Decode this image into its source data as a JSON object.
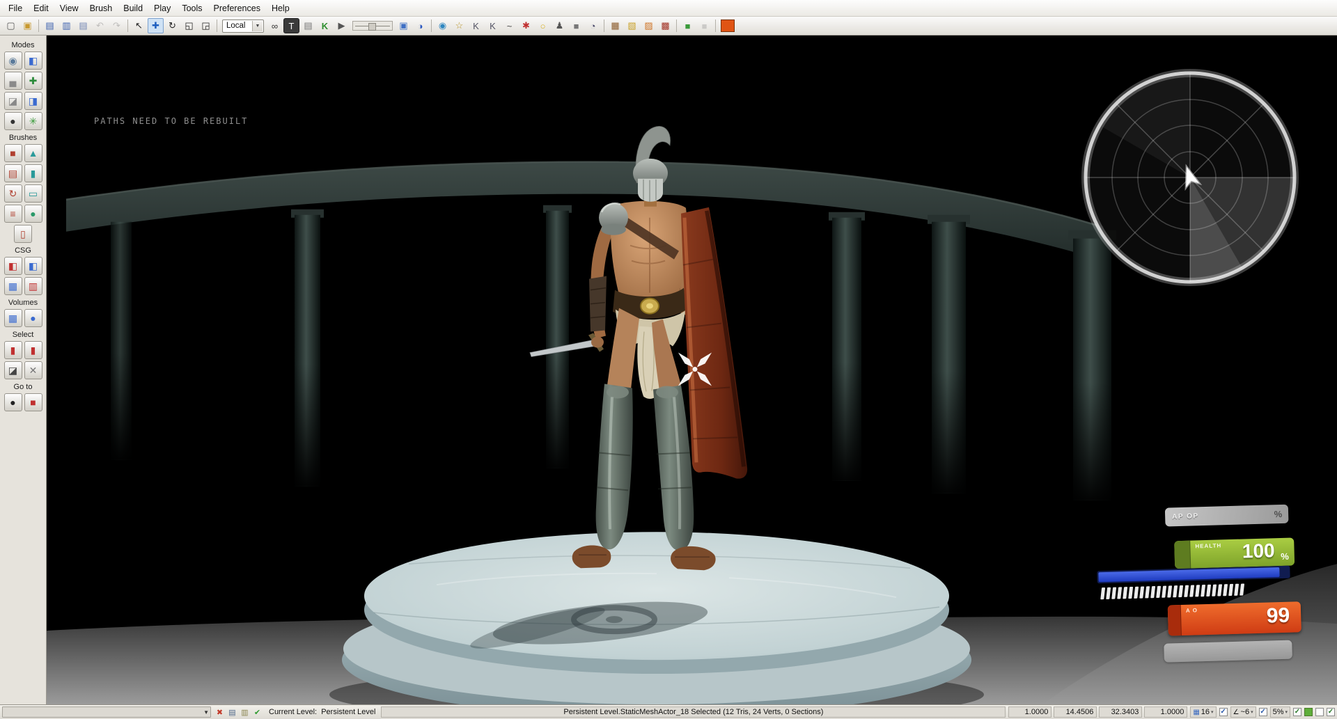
{
  "menu": {
    "items": [
      "File",
      "Edit",
      "View",
      "Brush",
      "Build",
      "Play",
      "Tools",
      "Preferences",
      "Help"
    ]
  },
  "toolbar": {
    "combo_value": "Local",
    "items": [
      {
        "name": "new-level",
        "glyph": "▢",
        "color": "#555"
      },
      {
        "name": "open-level",
        "glyph": "▣",
        "color": "#c8992f"
      },
      {
        "sep": true
      },
      {
        "name": "save-current-level",
        "glyph": "▤",
        "color": "#3a5fae"
      },
      {
        "name": "save-all-levels",
        "glyph": "▥",
        "color": "#3a5fae"
      },
      {
        "name": "save-all-writable",
        "glyph": "▤",
        "color": "#7387b5"
      },
      {
        "name": "undo",
        "glyph": "↶",
        "color": "#777",
        "disabled": true
      },
      {
        "name": "redo",
        "glyph": "↷",
        "color": "#777",
        "disabled": true
      },
      {
        "sep": true
      },
      {
        "name": "selection-tool",
        "glyph": "↖",
        "color": "#222"
      },
      {
        "name": "translate-tool",
        "glyph": "✚",
        "color": "#1f5fbf",
        "active": true
      },
      {
        "name": "rotate-tool",
        "glyph": "↻",
        "color": "#222"
      },
      {
        "name": "scale-tool",
        "glyph": "◱",
        "color": "#222"
      },
      {
        "name": "nonuniform-scale-tool",
        "glyph": "◲",
        "color": "#222"
      },
      {
        "sep": true
      },
      {
        "combo": true,
        "name": "reference-coordinate-system"
      },
      {
        "name": "search-for-actors",
        "glyph": "∞",
        "color": "#333"
      },
      {
        "name": "content-browser",
        "glyph": "T",
        "color": "#ffffff",
        "bg": "#3a3a3a"
      },
      {
        "name": "generic-browser",
        "glyph": "▤",
        "color": "#777"
      },
      {
        "name": "open-kismet",
        "glyph": "K",
        "color": "#2d8f2d",
        "bold": true
      },
      {
        "name": "open-matinee",
        "glyph": "▶",
        "color": "#555"
      },
      {
        "wide": true,
        "name": "distribution-widget"
      },
      {
        "name": "package-folder",
        "glyph": "▣",
        "color": "#3e6fc4"
      },
      {
        "name": "toggle-brush-polys",
        "glyph": "◑",
        "color": "#2a58c0"
      },
      {
        "sep": true
      },
      {
        "name": "build-geometry",
        "glyph": "◉",
        "color": "#2e86c0"
      },
      {
        "name": "favorites",
        "glyph": "☆",
        "color": "#b8952a"
      },
      {
        "name": "camera-speed-slow",
        "glyph": "K",
        "color": "#556"
      },
      {
        "name": "camera-speed-fast",
        "glyph": "K",
        "color": "#556"
      },
      {
        "name": "curve-editor",
        "glyph": "~",
        "color": "#444"
      },
      {
        "name": "build-ai-paths",
        "glyph": "✱",
        "color": "#c03030"
      },
      {
        "name": "build-lighting",
        "glyph": "○",
        "color": "#d8b020"
      },
      {
        "name": "build-cover-nodes",
        "glyph": "♟",
        "color": "#555"
      },
      {
        "name": "build-all",
        "glyph": "■",
        "color": "#777"
      },
      {
        "name": "build-progress-clock",
        "glyph": "◔",
        "color": "#446"
      },
      {
        "sep": true
      },
      {
        "name": "terrain-tool",
        "glyph": "▦",
        "color": "#8a5a2a"
      },
      {
        "name": "lightmass-tool",
        "glyph": "▧",
        "color": "#c9a22a"
      },
      {
        "name": "swarm-agent",
        "glyph": "▨",
        "color": "#cf7426"
      },
      {
        "name": "map-errors",
        "glyph": "▩",
        "color": "#a23326"
      },
      {
        "sep": true
      },
      {
        "name": "play-in-editor",
        "glyph": "■",
        "color": "#3a9a3a"
      },
      {
        "name": "play-on-device",
        "glyph": "■",
        "color": "#999",
        "disabled": true
      },
      {
        "sep": true
      },
      {
        "name": "realtime-preview-swatch",
        "swatch": "#e05414"
      }
    ]
  },
  "sidebar": {
    "sections": [
      {
        "label": "Modes",
        "items": [
          {
            "name": "mode-camera",
            "glyph": "◉",
            "color": "#5a7a9a"
          },
          {
            "name": "mode-geometry",
            "glyph": "◧",
            "color": "#3a6ad0"
          },
          {
            "name": "mode-terrain",
            "glyph": "▄",
            "color": "#8a8a8a"
          },
          {
            "name": "mode-translate",
            "glyph": "✚",
            "color": "#2a8a3a"
          },
          {
            "name": "mode-texture-align",
            "glyph": "◪",
            "color": "#888"
          },
          {
            "name": "mode-mesh-paint",
            "glyph": "◨",
            "color": "#3a6ad0"
          },
          {
            "name": "mode-geometry-edit",
            "glyph": "●",
            "color": "#333"
          },
          {
            "name": "mode-foliage",
            "glyph": "✳",
            "color": "#3a9a3a"
          }
        ]
      },
      {
        "label": "Brushes",
        "items": [
          {
            "name": "brush-cube",
            "glyph": "■",
            "color": "#b04030"
          },
          {
            "name": "brush-cone",
            "glyph": "▲",
            "color": "#2a9a9a"
          },
          {
            "name": "brush-curved-stair",
            "glyph": "▤",
            "color": "#b04030"
          },
          {
            "name": "brush-cylinder",
            "glyph": "▮",
            "color": "#2a9a9a"
          },
          {
            "name": "brush-spiral-stair",
            "glyph": "↻",
            "color": "#b04030"
          },
          {
            "name": "brush-sheet",
            "glyph": "▭",
            "color": "#2a9a9a"
          },
          {
            "name": "brush-linear-stair",
            "glyph": "≡",
            "color": "#b04030"
          },
          {
            "name": "brush-sphere",
            "glyph": "●",
            "color": "#2a9a6a"
          },
          {
            "name": "brush-volumetric",
            "glyph": "▯",
            "color": "#b04030"
          }
        ]
      },
      {
        "label": "CSG",
        "items": [
          {
            "name": "csg-add",
            "glyph": "◧",
            "color": "#c03030"
          },
          {
            "name": "csg-subtract",
            "glyph": "◧",
            "color": "#3a6ad0"
          },
          {
            "name": "csg-intersect",
            "glyph": "▦",
            "color": "#3a6ad0"
          },
          {
            "name": "csg-deintersect",
            "glyph": "▥",
            "color": "#c03030"
          }
        ]
      },
      {
        "label": "Volumes",
        "items": [
          {
            "name": "volume-add",
            "glyph": "▦",
            "color": "#3a6ad0"
          },
          {
            "name": "volume-sphere",
            "glyph": "●",
            "color": "#3a6ad0"
          }
        ]
      },
      {
        "label": "Select",
        "items": [
          {
            "name": "select-add",
            "glyph": "▮",
            "color": "#c03030"
          },
          {
            "name": "select-remove",
            "glyph": "▮",
            "color": "#c03030"
          },
          {
            "name": "select-invert",
            "glyph": "◪",
            "color": "#444"
          },
          {
            "name": "select-none",
            "glyph": "✕",
            "color": "#777"
          }
        ]
      },
      {
        "label": "Go to",
        "items": [
          {
            "name": "goto-actor",
            "glyph": "●",
            "color": "#222"
          },
          {
            "name": "goto-builder-brush",
            "glyph": "■",
            "color": "#c03030"
          }
        ]
      }
    ]
  },
  "viewport": {
    "warning": "PATHS NEED TO BE REBUILT"
  },
  "hud": {
    "armor": {
      "label": "AP OP",
      "unit": "%"
    },
    "health": {
      "label": "HEALTH",
      "value": "100",
      "unit": "%"
    },
    "stamina_ticks": 26,
    "vitality": {
      "label": "A O",
      "value": "99"
    }
  },
  "statusbar": {
    "current_level_label": "Current Level:",
    "current_level_value": "Persistent Level",
    "selection_text": "Persistent Level.StaticMeshActor_18 Selected (12 Tris, 24 Verts, 0 Sections)",
    "fields": [
      "1.0000",
      "14.4506",
      "32.3403",
      "1.0000"
    ],
    "grid_value": "16",
    "angle_value": "~6",
    "scale_value": "5%",
    "icons": [
      {
        "name": "map-check-error-icon",
        "glyph": "✖",
        "color": "#c23a2a"
      },
      {
        "name": "package-status-icon",
        "glyph": "▤",
        "color": "#50688a"
      },
      {
        "name": "lighting-status-icon",
        "glyph": "▥",
        "color": "#8a8450"
      },
      {
        "name": "source-control-ok-icon",
        "glyph": "✔",
        "color": "#2f9a2f"
      }
    ]
  }
}
